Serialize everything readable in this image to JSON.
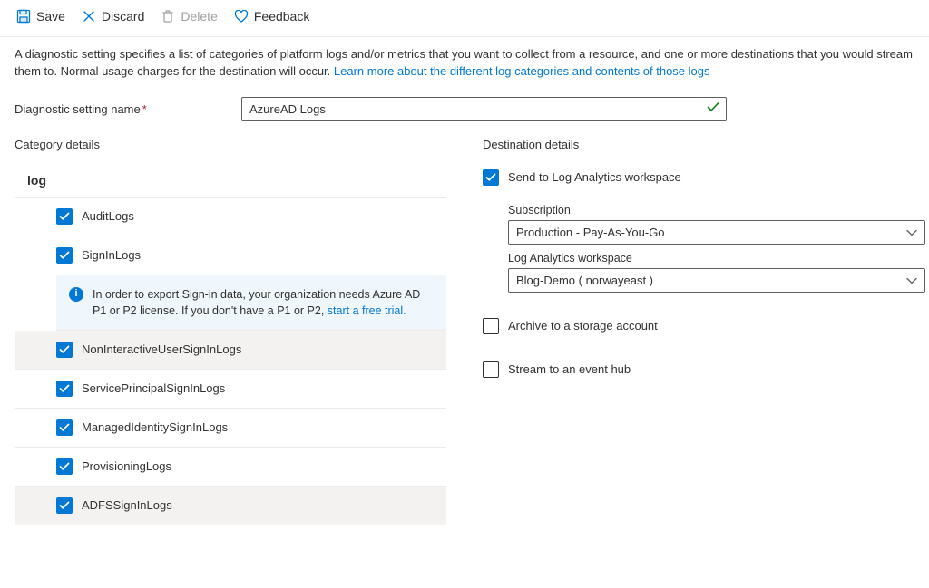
{
  "toolbar": {
    "save": "Save",
    "discard": "Discard",
    "delete": "Delete",
    "feedback": "Feedback"
  },
  "intro": {
    "text": "A diagnostic setting specifies a list of categories of platform logs and/or metrics that you want to collect from a resource, and one or more destinations that you would stream them to. Normal usage charges for the destination will occur. ",
    "link": "Learn more about the different log categories and contents of those logs"
  },
  "nameField": {
    "label": "Diagnostic setting name",
    "value": "AzureAD Logs"
  },
  "category": {
    "header": "Category details",
    "group": "log",
    "items": [
      {
        "label": "AuditLogs",
        "checked": true,
        "shaded": false
      },
      {
        "label": "SignInLogs",
        "checked": true,
        "shaded": false
      },
      {
        "label": "NonInteractiveUserSignInLogs",
        "checked": true,
        "shaded": true
      },
      {
        "label": "ServicePrincipalSignInLogs",
        "checked": true,
        "shaded": false
      },
      {
        "label": "ManagedIdentitySignInLogs",
        "checked": true,
        "shaded": false
      },
      {
        "label": "ProvisioningLogs",
        "checked": true,
        "shaded": false
      },
      {
        "label": "ADFSSignInLogs",
        "checked": true,
        "shaded": true
      }
    ],
    "info": {
      "text": "In order to export Sign-in data, your organization needs Azure AD P1 or P2 license. If you don't have a P1 or P2,  ",
      "link": "start a free trial."
    }
  },
  "destination": {
    "header": "Destination details",
    "sendLA": {
      "label": "Send to Log Analytics workspace",
      "checked": true
    },
    "subscription": {
      "label": "Subscription",
      "value": "Production - Pay-As-You-Go"
    },
    "workspace": {
      "label": "Log Analytics workspace",
      "value": "Blog-Demo ( norwayeast )"
    },
    "archive": {
      "label": "Archive to a storage account",
      "checked": false
    },
    "stream": {
      "label": "Stream to an event hub",
      "checked": false
    }
  }
}
